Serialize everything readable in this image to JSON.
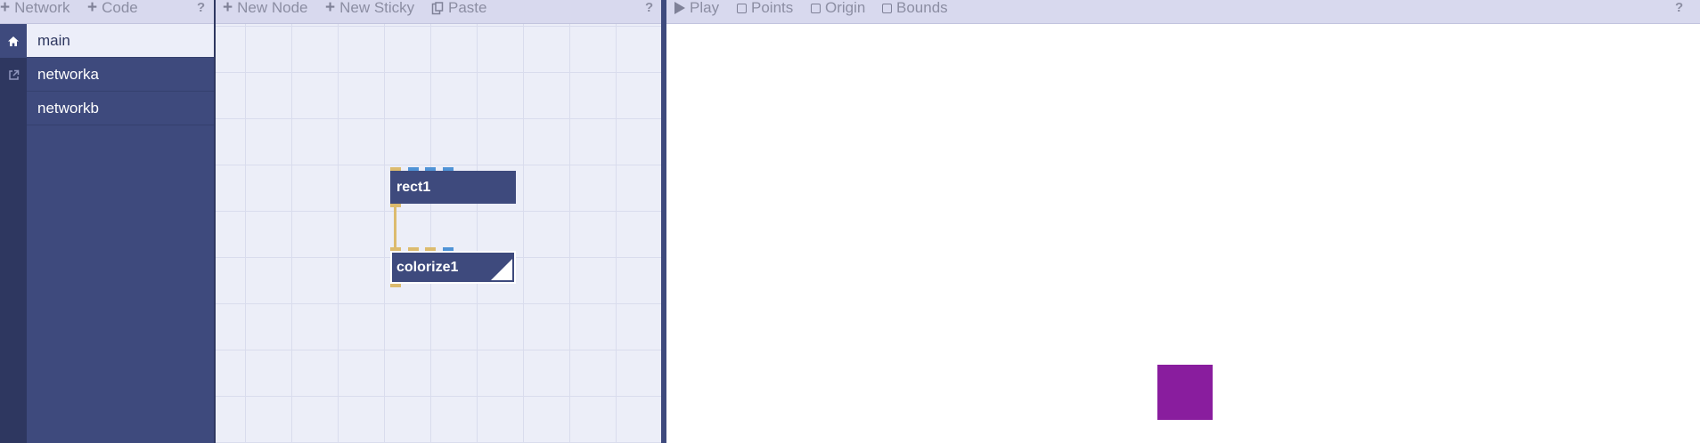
{
  "network_toolbar": {
    "network_label": "Network",
    "code_label": "Code",
    "help": "?"
  },
  "editor_toolbar": {
    "new_node_label": "New Node",
    "new_sticky_label": "New Sticky",
    "paste_label": "Paste",
    "help": "?"
  },
  "viewer_toolbar": {
    "play_label": "Play",
    "points_label": "Points",
    "origin_label": "Origin",
    "bounds_label": "Bounds",
    "help": "?"
  },
  "networks": [
    {
      "label": "main",
      "selected": true
    },
    {
      "label": "networka",
      "selected": false
    },
    {
      "label": "networkb",
      "selected": false
    }
  ],
  "sidebar_icons": [
    "home-icon",
    "external-link-icon"
  ],
  "nodes": [
    {
      "label": "rect1"
    },
    {
      "label": "colorize1",
      "rendered": true
    }
  ],
  "viewer": {
    "shape_color": "#891d9e"
  },
  "colors": {
    "panel_dark": "#2e3760",
    "panel": "#3e4a7d",
    "toolbar": "#d8d9ee",
    "port_yellow": "#dcbb6e",
    "port_blue": "#4f93d6"
  }
}
